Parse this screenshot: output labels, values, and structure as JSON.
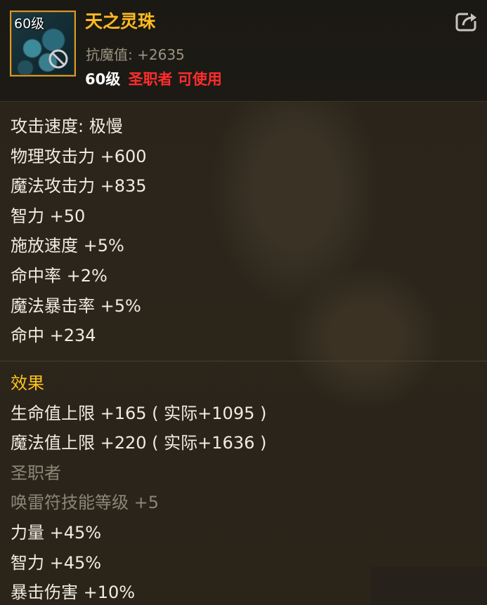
{
  "item": {
    "icon_level": "60级",
    "icon_name": "pearl-item-icon",
    "name": "天之灵珠",
    "resist_label": "抗魔值:",
    "resist_value": "+2635",
    "req_level": "60级",
    "req_class": "圣职者 可使用"
  },
  "colors": {
    "name": "#ffba21",
    "requirement_warning": "#ff2d2d",
    "section_title": "#ffc21b",
    "dim_text": "#8c8678"
  },
  "stats": [
    "攻击速度: 极慢",
    "物理攻击力 +600",
    "魔法攻击力 +835",
    "智力 +50",
    "施放速度 +5%",
    "命中率 +2%",
    "魔法暴击率 +5%",
    "命中 +234"
  ],
  "effects": {
    "title": "效果",
    "lines": [
      "生命值上限 +165 ( 实际+1095 )",
      "魔法值上限 +220 ( 实际+1636 )"
    ],
    "class_header": "圣职者",
    "class_lines": [
      "唤雷符技能等级 +5"
    ],
    "extra_lines": [
      "力量 +45%",
      "智力 +45%",
      "暴击伤害 +10%"
    ]
  }
}
